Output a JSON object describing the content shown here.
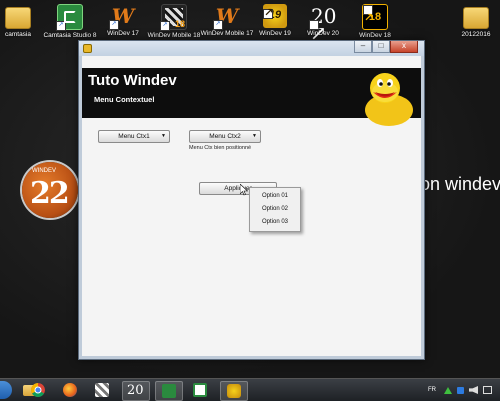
{
  "desktop": {
    "icons": [
      {
        "label": "camtasia",
        "kind": "folder"
      },
      {
        "label": "Camtasia Studio 8",
        "kind": "camstudio"
      },
      {
        "label": "WinDev 17",
        "kind": "windev"
      },
      {
        "label": "WinDev Mobile 18",
        "kind": "mobile"
      },
      {
        "label": "WinDev Mobile 17",
        "kind": "windev"
      },
      {
        "label": "WinDev 19",
        "kind": "windev19"
      },
      {
        "label": "WinDev 20",
        "kind": "windev20"
      },
      {
        "label": "WinDev 18",
        "kind": "windev18"
      },
      {
        "label": "20122016",
        "kind": "folder"
      }
    ],
    "shortcut_arrow": "↗",
    "mobile_badge": "18",
    "windev19_badge": "19",
    "windev20_badge": "20",
    "windev18_badge": "18",
    "windev_letter": "W",
    "logo22": {
      "brand": "WINDEV",
      "number": "22"
    },
    "background_text": "on windev"
  },
  "window": {
    "buttons": {
      "minimize": "–",
      "maximize": "□",
      "close": "x"
    },
    "header": {
      "title": "Tuto Windev",
      "subtitle": "Menu Contextuel"
    },
    "btn_ctx1": {
      "label": "Menu Ctx1",
      "arrow": "▼"
    },
    "btn_ctx2": {
      "label": "Menu Ctx2",
      "arrow": "▼"
    },
    "caption": "Menu Ctx bien positionné",
    "apply_button": {
      "label": "Appliquer"
    },
    "context_menu": [
      "Option 01",
      "Option 02",
      "Option 03"
    ]
  },
  "taskbar": {
    "items": [
      {
        "name": "explorer",
        "active": false
      },
      {
        "name": "chrome",
        "active": false
      },
      {
        "name": "firefox",
        "active": false
      },
      {
        "name": "windev-app",
        "active": false
      },
      {
        "name": "windev20",
        "active": true,
        "text": "20"
      },
      {
        "name": "camtasia-studio",
        "active": true
      },
      {
        "name": "camtasia-recorder",
        "active": false
      },
      {
        "name": "windev-running",
        "active": true
      }
    ],
    "tray": {
      "language": "FR"
    }
  },
  "colors": {
    "header_bg": "#0d0d0d",
    "windev_orange": "#e07a1a",
    "duck_yellow": "#f7d21b"
  }
}
